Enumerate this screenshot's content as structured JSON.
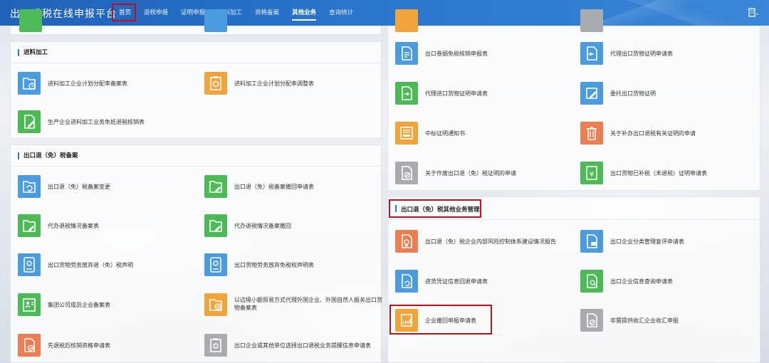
{
  "app_title": "出口退税在线申报平台",
  "nav": [
    {
      "label": "首页"
    },
    {
      "label": "退税申报"
    },
    {
      "label": "证明申报"
    },
    {
      "label": "进料加工"
    },
    {
      "label": "资格备案"
    },
    {
      "label": "其他业务"
    },
    {
      "label": "查询统计"
    }
  ],
  "icons": {
    "user": "building-user-icon",
    "dropdown": "caret-down-icon"
  },
  "colors": {
    "primary": "#2a74cc",
    "highlight": "#c0101a",
    "blue": "#4a9be0",
    "orange": "#f2a33a",
    "green": "#4dbb55",
    "coral": "#ee7d52",
    "grey": "#a9acaf"
  },
  "left": {
    "jinliao": {
      "title": "进料加工",
      "items": [
        {
          "label": "进料加工企业计划分配率备案表",
          "icon": "folder-clock-icon"
        },
        {
          "label": "进料加工企业计划分配率调整表",
          "icon": "clipboard-gear-icon"
        },
        {
          "label": "生产企业进料加工业务免抵退税核销表",
          "icon": "document-edit-icon"
        }
      ]
    },
    "beian": {
      "title": "出口退（免）税备案",
      "items": [
        {
          "label": "出口退（免）税备案变更",
          "icon": "folder-refresh-icon"
        },
        {
          "label": "出口退（免）税备案撤回申请表",
          "icon": "folder-edit-icon"
        },
        {
          "label": "代办退税情况备案表",
          "icon": "folder-edit-icon"
        },
        {
          "label": "代办退税情况备案撤回",
          "icon": "folder-edit-icon"
        },
        {
          "label": "出口货物劳务放弃退（免）税声明",
          "icon": "tablet-icon"
        },
        {
          "label": "出口货物劳务放弃免税权声明表",
          "icon": "tablet-icon"
        },
        {
          "label": "集团公司成员企业备案表",
          "icon": "id-card-icon"
        },
        {
          "label": "以边境小额贸易方式代理外国企业、外国自然人报关出口货物备案表",
          "icon": "folder-globe-icon"
        },
        {
          "label": "先退税后核销资格申请表",
          "icon": "document-check-icon"
        },
        {
          "label": "出口企业或其他单位选择出口退税业务提醒信息申请表",
          "icon": "clipboard-icon"
        }
      ]
    }
  },
  "right": {
    "proof": {
      "items": [
        {
          "label": "出口卷烟免税核销申报表",
          "icon": "document-stamp-icon"
        },
        {
          "label": "代理出口货物证明申请表",
          "icon": "document-return-icon"
        },
        {
          "label": "代理进口货物证明申请表",
          "icon": "document-import-icon"
        },
        {
          "label": "委托出口货物证明",
          "icon": "pencil-icon"
        },
        {
          "label": "中标证明通知书",
          "icon": "certificate-icon"
        },
        {
          "label": "关于补办出口退税有关证明的申请",
          "icon": "trash-document-icon"
        },
        {
          "label": "关于作废出口退（免）税证明的申请",
          "icon": "document-cancel-icon"
        },
        {
          "label": "出口货物已补税（未退税）证明申请表",
          "icon": "money-document-icon"
        }
      ]
    },
    "other": {
      "title": "出口退（免）税其他业务管理",
      "items": [
        {
          "label": "出口退（免）税企业内部风险控制体系建设情况报告",
          "icon": "document-award-icon"
        },
        {
          "label": "出口企业分类管理复评申请表",
          "icon": "document-user-icon"
        },
        {
          "label": "进货凭证信息回退申请表",
          "icon": "document-refresh-icon"
        },
        {
          "label": "出口企业信息查询申请表",
          "icon": "document-search-icon"
        },
        {
          "label": "企业撤回申报申请表",
          "icon": "chart-document-icon"
        },
        {
          "label": "非需提供收汇企业收汇申报",
          "icon": "document-cancel-icon"
        }
      ]
    }
  }
}
